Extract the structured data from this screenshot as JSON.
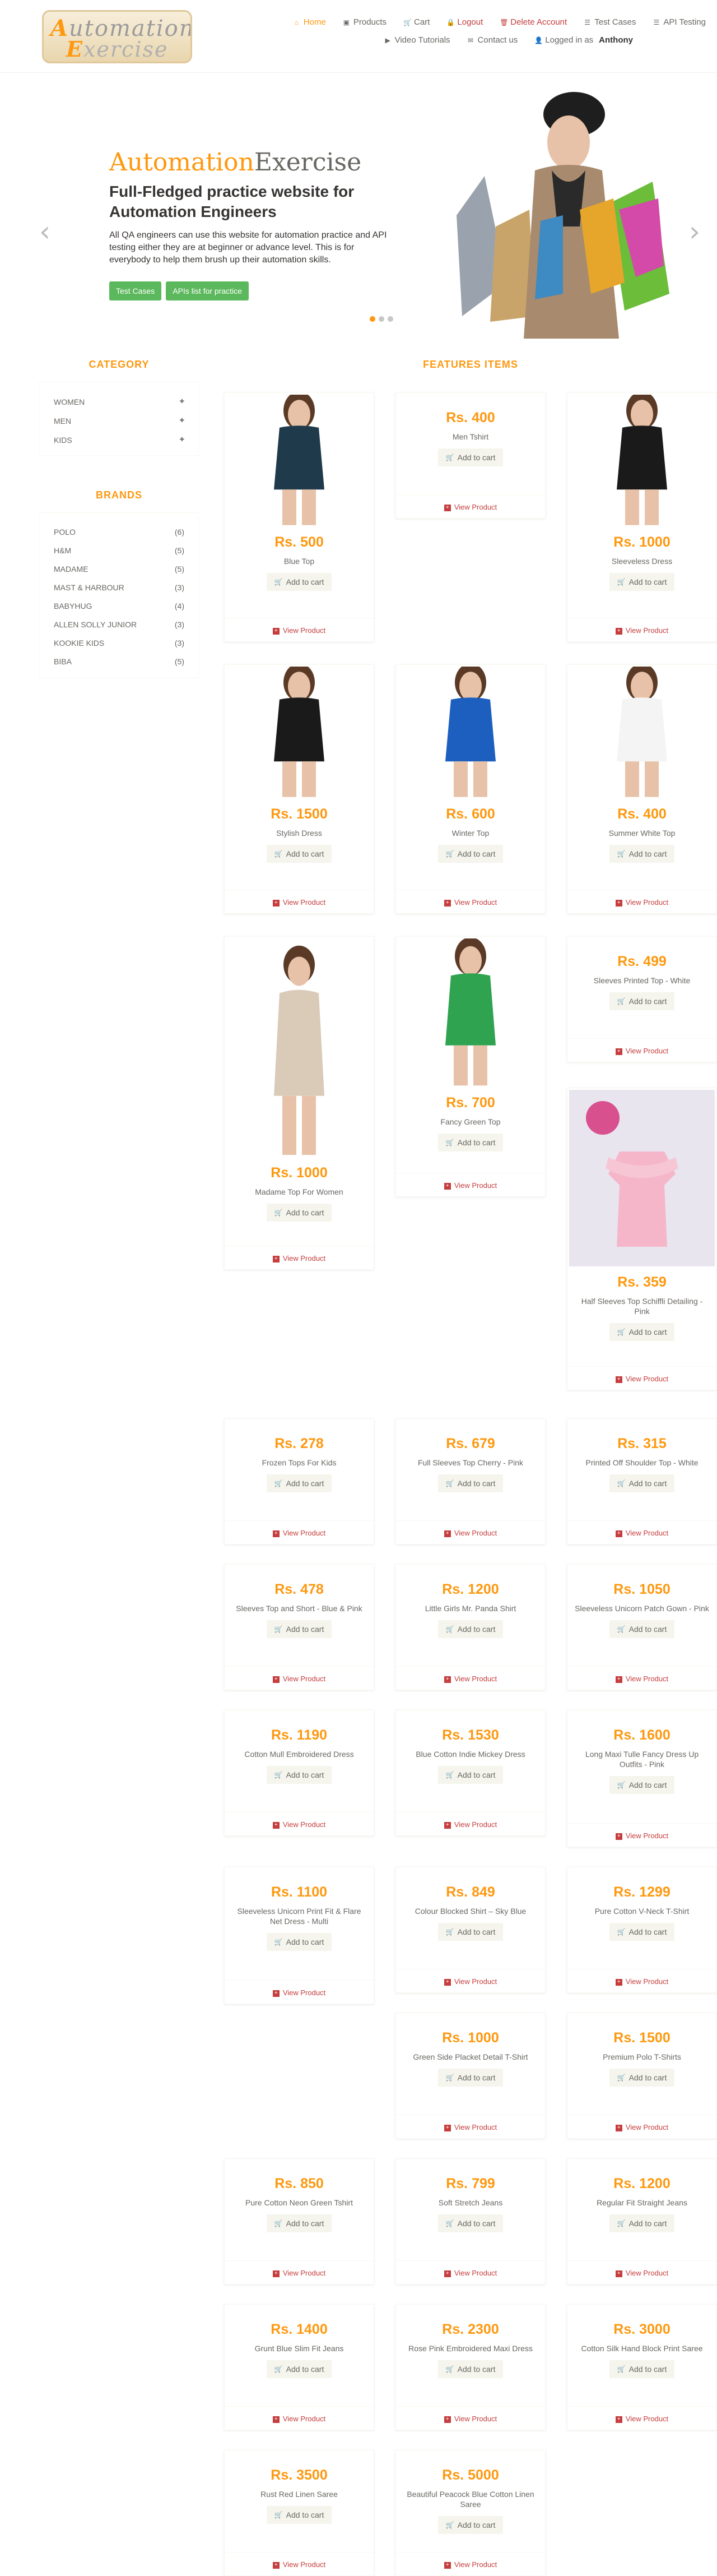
{
  "logo": {
    "line1_cap": "A",
    "line1_rest": "utomation",
    "line2_cap": "E",
    "line2_rest": "xercise"
  },
  "nav": {
    "home": "Home",
    "products": "Products",
    "cart": "Cart",
    "logout": "Logout",
    "delete_account": "Delete Account",
    "test_cases": "Test Cases",
    "api_testing": "API Testing",
    "video_tutorials": "Video Tutorials",
    "contact_us": "Contact us",
    "logged_in_as": "Logged in as",
    "username": "Anthony"
  },
  "hero": {
    "title_a": "Automation",
    "title_b": "Exercise",
    "subtitle": "Full-Fledged practice website for Automation Engineers",
    "text": "All QA engineers can use this website for automation practice and API testing either they are at beginner or advance level. This is for everybody to help them brush up their automation skills.",
    "btn_test_cases": "Test Cases",
    "btn_apis": "APIs list for practice"
  },
  "sidebar": {
    "category_title": "CATEGORY",
    "categories": [
      "WOMEN",
      "MEN",
      "KIDS"
    ],
    "brands_title": "BRANDS",
    "brands": [
      {
        "name": "POLO",
        "count": "(6)"
      },
      {
        "name": "H&M",
        "count": "(5)"
      },
      {
        "name": "MADAME",
        "count": "(5)"
      },
      {
        "name": "MAST & HARBOUR",
        "count": "(3)"
      },
      {
        "name": "BABYHUG",
        "count": "(4)"
      },
      {
        "name": "ALLEN SOLLY JUNIOR",
        "count": "(3)"
      },
      {
        "name": "KOOKIE KIDS",
        "count": "(3)"
      },
      {
        "name": "BIBA",
        "count": "(5)"
      }
    ]
  },
  "features_title": "FEATURES ITEMS",
  "add_to_cart": "Add to cart",
  "view_product": "View Product",
  "products": [
    {
      "price": "Rs. 500",
      "name": "Blue Top"
    },
    {
      "price": "Rs. 400",
      "name": "Men Tshirt"
    },
    {
      "price": "Rs. 1000",
      "name": "Sleeveless Dress"
    },
    {
      "price": "Rs. 1500",
      "name": "Stylish Dress"
    },
    {
      "price": "Rs. 600",
      "name": "Winter Top"
    },
    {
      "price": "Rs. 400",
      "name": "Summer White Top"
    },
    {
      "price": "Rs. 1000",
      "name": "Madame Top For Women"
    },
    {
      "price": "Rs. 700",
      "name": "Fancy Green Top"
    },
    {
      "price": "Rs. 499",
      "name": "Sleeves Printed Top - White"
    },
    {
      "price": "Rs. 359",
      "name": "Half Sleeves Top Schiffli Detailing - Pink"
    },
    {
      "price": "Rs. 278",
      "name": "Frozen Tops For Kids"
    },
    {
      "price": "Rs. 679",
      "name": "Full Sleeves Top Cherry - Pink"
    },
    {
      "price": "Rs. 315",
      "name": "Printed Off Shoulder Top - White"
    },
    {
      "price": "Rs. 478",
      "name": "Sleeves Top and Short - Blue & Pink"
    },
    {
      "price": "Rs. 1200",
      "name": "Little Girls Mr. Panda Shirt"
    },
    {
      "price": "Rs. 1050",
      "name": "Sleeveless Unicorn Patch Gown - Pink"
    },
    {
      "price": "Rs. 1190",
      "name": "Cotton Mull Embroidered Dress"
    },
    {
      "price": "Rs. 1530",
      "name": "Blue Cotton Indie Mickey Dress"
    },
    {
      "price": "Rs. 1600",
      "name": "Long Maxi Tulle Fancy Dress Up Outfits - Pink"
    },
    {
      "price": "Rs. 1100",
      "name": "Sleeveless Unicorn Print Fit & Flare Net Dress - Multi"
    },
    {
      "price": "Rs. 849",
      "name": "Colour Blocked Shirt – Sky Blue"
    },
    {
      "price": "Rs. 1299",
      "name": "Pure Cotton V-Neck T-Shirt"
    },
    {
      "price": "Rs. 1000",
      "name": "Green Side Placket Detail T-Shirt"
    },
    {
      "price": "Rs. 1500",
      "name": "Premium Polo T-Shirts"
    },
    {
      "price": "Rs. 850",
      "name": "Pure Cotton Neon Green Tshirt"
    },
    {
      "price": "Rs. 799",
      "name": "Soft Stretch Jeans"
    },
    {
      "price": "Rs. 1200",
      "name": "Regular Fit Straight Jeans"
    },
    {
      "price": "Rs. 1400",
      "name": "Grunt Blue Slim Fit Jeans"
    },
    {
      "price": "Rs. 2300",
      "name": "Rose Pink Embroidered Maxi Dress"
    },
    {
      "price": "Rs. 3000",
      "name": "Cotton Silk Hand Block Print Saree"
    },
    {
      "price": "Rs. 3500",
      "name": "Rust Red Linen Saree"
    },
    {
      "price": "Rs. 5000",
      "name": "Beautiful Peacock Blue Cotton Linen Saree"
    }
  ]
}
